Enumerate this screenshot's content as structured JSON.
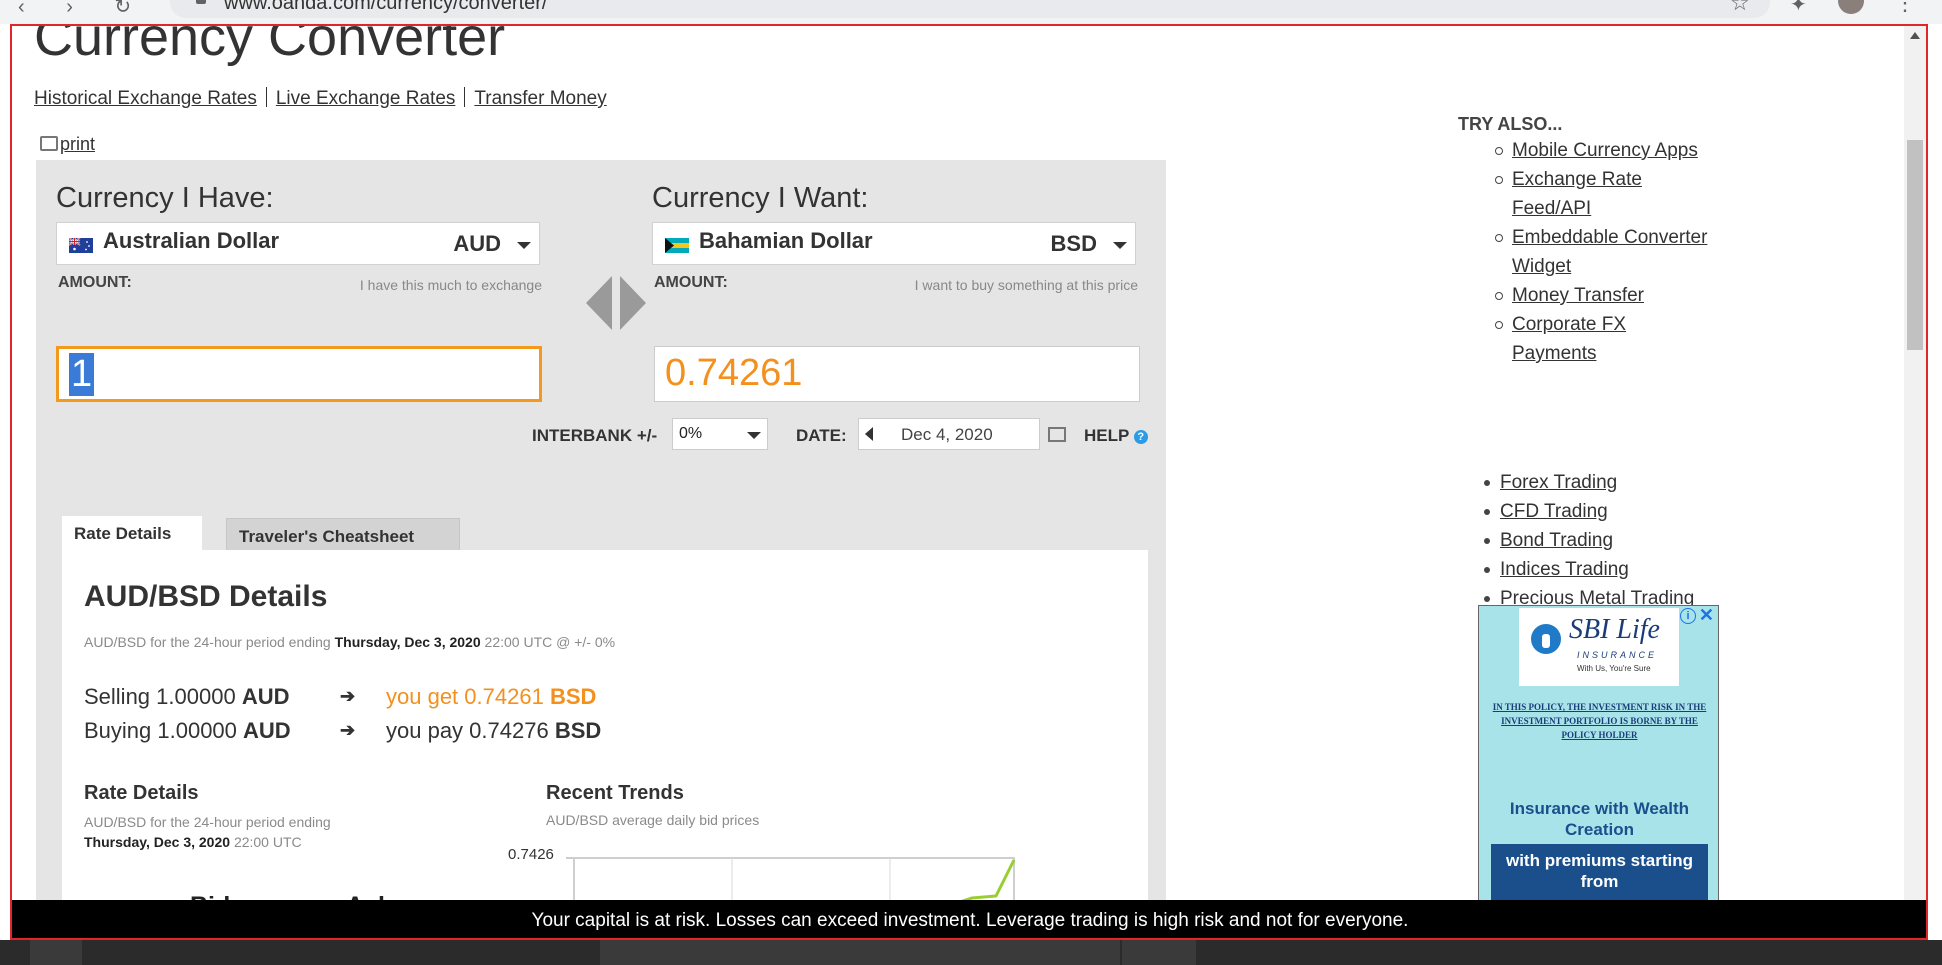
{
  "browser": {
    "url": "www.oanda.com/currency/converter/"
  },
  "page": {
    "title": "Currency Converter",
    "links": [
      "Historical Exchange Rates",
      "Live Exchange Rates",
      "Transfer Money"
    ],
    "print": "print"
  },
  "converter": {
    "have": {
      "heading": "Currency I Have:",
      "currency": "Australian Dollar",
      "code": "AUD",
      "amount_label": "AMOUNT:",
      "hint": "I have this much to exchange",
      "amount": "1"
    },
    "want": {
      "heading": "Currency I Want:",
      "currency": "Bahamian Dollar",
      "code": "BSD",
      "amount_label": "AMOUNT:",
      "hint": "I want to buy something at this price",
      "amount": "0.74261"
    },
    "interbank_label": "INTERBANK +/-",
    "interbank_value": "0%",
    "date_label": "DATE:",
    "date_value": "Dec 4, 2020",
    "help": "HELP",
    "help_icon": "?"
  },
  "tabs": [
    "Rate Details",
    "Traveler's Cheatsheet"
  ],
  "details": {
    "title": "AUD/BSD Details",
    "period_prefix": "AUD/BSD for the 24-hour period ending",
    "period_date": "Thursday, Dec 3, 2020",
    "period_suffix": "22:00 UTC @ +/- 0%",
    "selling": {
      "prefix": "Selling 1.00000",
      "code": "AUD",
      "arrow": "➔",
      "result": "you get 0.74261",
      "result_code": "BSD"
    },
    "buying": {
      "prefix": "Buying 1.00000",
      "code": "AUD",
      "arrow": "➔",
      "result": "you pay 0.74276",
      "result_code": "BSD"
    },
    "rate_details": {
      "heading": "Rate Details",
      "sub": "AUD/BSD for the 24-hour period ending",
      "date": "Thursday, Dec 3, 2020",
      "time": "22:00 UTC"
    },
    "recent_trends": {
      "heading": "Recent Trends",
      "sub": "AUD/BSD average daily bid prices"
    },
    "bid": "Bid",
    "ask": "Ask"
  },
  "trend_chart": {
    "y_top_label": "0.7426"
  },
  "sidebar": {
    "try_title": "TRY ALSO...",
    "try_links": [
      "Mobile Currency Apps",
      "Exchange Rate Feed/API",
      "Embeddable Converter Widget",
      "Money Transfer",
      "Corporate FX Payments"
    ],
    "trading_links": [
      "Forex Trading",
      "CFD Trading",
      "Bond Trading",
      "Indices Trading",
      "Precious Metal Trading"
    ]
  },
  "ad": {
    "brand": "SBI Life",
    "brand_sub": "INSURANCE",
    "tagline": "With Us, You're Sure",
    "info": "i",
    "close": "✕",
    "disclaimer": "IN THIS POLICY, THE INVESTMENT RISK IN THE INVESTMENT PORTFOLIO IS BORNE BY THE POLICY HOLDER",
    "headline": "Insurance with Wealth Creation",
    "band": "with premiums starting from"
  },
  "risk_banner": "Your capital is at risk. Losses can exceed investment. Leverage trading is high risk and not for everyone.",
  "colors": {
    "accent_orange": "#f3901e",
    "focus_border": "#f39a1e",
    "frame_border": "#e0262b",
    "panel_bg": "#e5e5e5"
  }
}
